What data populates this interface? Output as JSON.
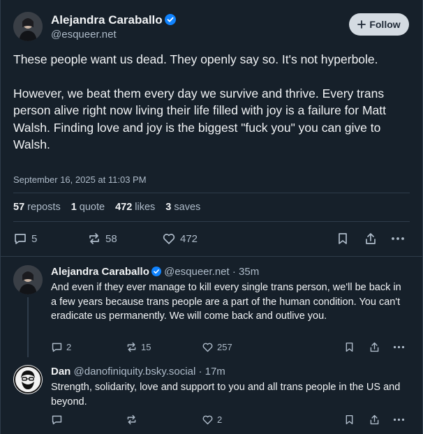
{
  "post": {
    "author_name": "Alejandra Caraballo",
    "handle": "@esqueer.net",
    "follow_label": "Follow",
    "text_paragraphs": [
      "These people want us dead. They openly say so. It's not hyperbole.",
      "However, we beat them every day we survive and thrive. Every trans person alive right now living their life filled with joy is a failure for Matt Walsh. Finding love and joy is the biggest \"fuck you\" you can give to Walsh."
    ],
    "date": "September 16, 2025 at 11:03 PM",
    "stats": {
      "reposts_count": "57",
      "reposts_label": "reposts",
      "quotes_count": "1",
      "quotes_label": "quote",
      "likes_count": "472",
      "likes_label": "likes",
      "saves_count": "3",
      "saves_label": "saves"
    },
    "actions": {
      "replies": "5",
      "reposts": "58",
      "likes": "472"
    }
  },
  "replies": [
    {
      "author_name": "Alejandra Caraballo",
      "handle": "@esqueer.net",
      "time": "· 35m",
      "text": "And even if they ever manage to kill every single trans person, we'll be back in a few years because trans people are a part of the human condition. You can't eradicate us permanently. We will come back and outlive you.",
      "replies": "2",
      "reposts": "15",
      "likes": "257"
    },
    {
      "author_name": "Dan",
      "handle": "@danofiniquity.bsky.social",
      "time": "· 17m",
      "text": "Strength, solidarity, love and support to you and all trans people in the US and beyond.",
      "replies": "",
      "reposts": "",
      "likes": "2"
    }
  ],
  "colors": {
    "background": "#16202a",
    "text": "#f1f3f5",
    "muted": "#aebbc9",
    "verified": "#1083fe",
    "follow_bg": "#d4dbe2"
  },
  "icons": [
    "verified-badge-icon",
    "plus-icon",
    "reply-icon",
    "repost-icon",
    "like-icon",
    "bookmark-icon",
    "share-icon",
    "more-icon"
  ]
}
